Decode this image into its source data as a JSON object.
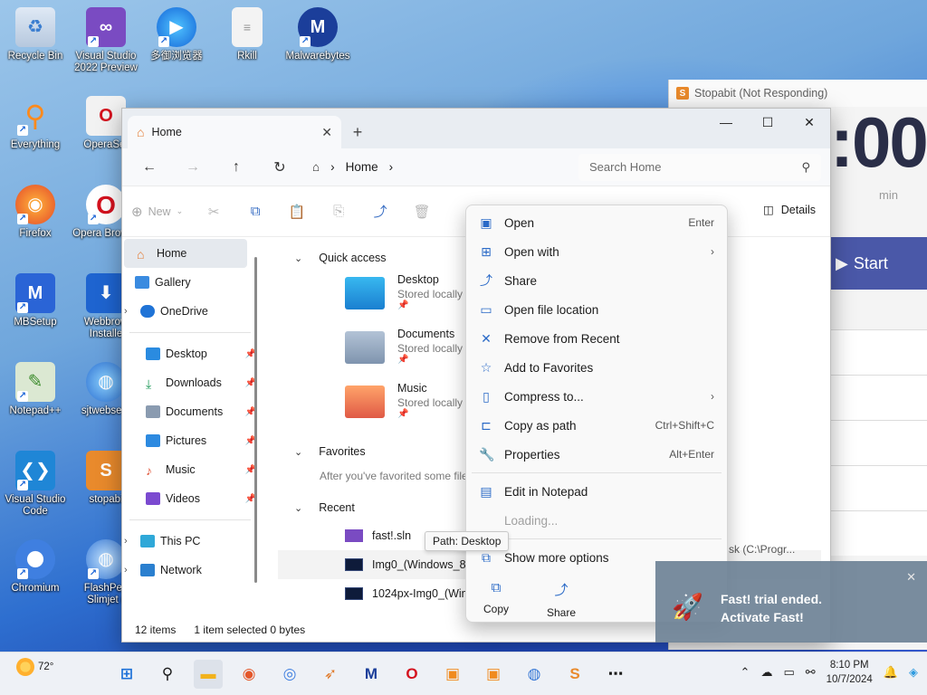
{
  "desktop_icons": [
    {
      "label": "Recycle Bin",
      "icon": "recycle-bin-icon"
    },
    {
      "label": "Visual Studio 2022 Preview",
      "icon": "visual-studio-preview-icon"
    },
    {
      "label": "多御浏览器",
      "icon": "browser-icon"
    },
    {
      "label": "Rkill",
      "icon": "document-icon"
    },
    {
      "label": "Malwarebytes",
      "icon": "malwarebytes-icon"
    },
    {
      "label": "Everything",
      "icon": "magnifier-icon"
    },
    {
      "label": "OperaSet",
      "icon": "opera-setup-icon"
    },
    {
      "label": "Firefox",
      "icon": "firefox-icon"
    },
    {
      "label": "Opera Browse",
      "icon": "opera-icon"
    },
    {
      "label": "MBSetup",
      "icon": "mbsetup-icon"
    },
    {
      "label": "Webbrow Installe",
      "icon": "installer-icon"
    },
    {
      "label": "Notepad++",
      "icon": "notepadpp-icon"
    },
    {
      "label": "sjtwebsetu",
      "icon": "globe-setup-icon"
    },
    {
      "label": "Visual Studio Code",
      "icon": "vscode-icon"
    },
    {
      "label": "stopabi",
      "icon": "stopabit-icon"
    },
    {
      "label": "Chromium",
      "icon": "chromium-icon"
    },
    {
      "label": "FlashPea Slimjet (",
      "icon": "slimjet-icon"
    }
  ],
  "stopabit": {
    "title": "Stopabit (Not Responding)",
    "time": ":00",
    "unit": "min",
    "start": "Start"
  },
  "explorer": {
    "tab_title": "Home",
    "address": "Home",
    "search_placeholder": "Search Home",
    "new_label": "New",
    "details_label": "Details",
    "sidebar": [
      {
        "label": "Home",
        "selected": true
      },
      {
        "label": "Gallery"
      },
      {
        "label": "OneDrive",
        "expandable": true
      },
      {
        "label": "Desktop",
        "pinned": true
      },
      {
        "label": "Downloads",
        "pinned": true
      },
      {
        "label": "Documents",
        "pinned": true
      },
      {
        "label": "Pictures",
        "pinned": true
      },
      {
        "label": "Music",
        "pinned": true
      },
      {
        "label": "Videos",
        "pinned": true
      },
      {
        "label": "This PC",
        "expandable": true
      },
      {
        "label": "Network",
        "expandable": true
      }
    ],
    "quick_access_label": "Quick access",
    "quick_access": [
      {
        "name": "Desktop",
        "sub": "Stored locally"
      },
      {
        "name": "Documents",
        "sub": "Stored locally"
      },
      {
        "name": "Music",
        "sub": "Stored locally"
      }
    ],
    "favorites_label": "Favorites",
    "favorites_hint": "After you've favorited some file",
    "recent_label": "Recent",
    "recent": [
      {
        "name": "fast!.sln"
      },
      {
        "name": "Img0_(Windows_8_"
      },
      {
        "name": "1024px-Img0_(Wind"
      }
    ],
    "recent_path": "sk (C:\\Progr...",
    "status_items": "12 items",
    "status_selected": "1 item selected",
    "status_size": "0 bytes"
  },
  "context_menu": {
    "items": [
      {
        "label": "Open",
        "shortcut": "Enter",
        "icon": "open-icon"
      },
      {
        "label": "Open with",
        "submenu": true,
        "icon": "open-with-icon"
      },
      {
        "label": "Share",
        "icon": "share-icon"
      },
      {
        "label": "Open file location",
        "icon": "folder-icon"
      },
      {
        "label": "Remove from Recent",
        "icon": "remove-icon"
      },
      {
        "label": "Add to Favorites",
        "icon": "star-icon"
      },
      {
        "label": "Compress to...",
        "submenu": true,
        "icon": "zip-icon"
      },
      {
        "label": "Copy as path",
        "shortcut": "Ctrl+Shift+C",
        "icon": "copy-path-icon"
      },
      {
        "label": "Properties",
        "shortcut": "Alt+Enter",
        "icon": "wrench-icon"
      }
    ],
    "edit_notepad": "Edit in Notepad",
    "loading": "Loading...",
    "more_options": "Show more options",
    "bottom_copy": "Copy",
    "bottom_share": "Share"
  },
  "tooltip": "Path: Desktop",
  "toast": {
    "line1": "Fast! trial ended.",
    "line2": "Activate Fast!"
  },
  "taskbar": {
    "temp": "72°",
    "time": "8:10 PM",
    "date": "10/7/2024"
  }
}
